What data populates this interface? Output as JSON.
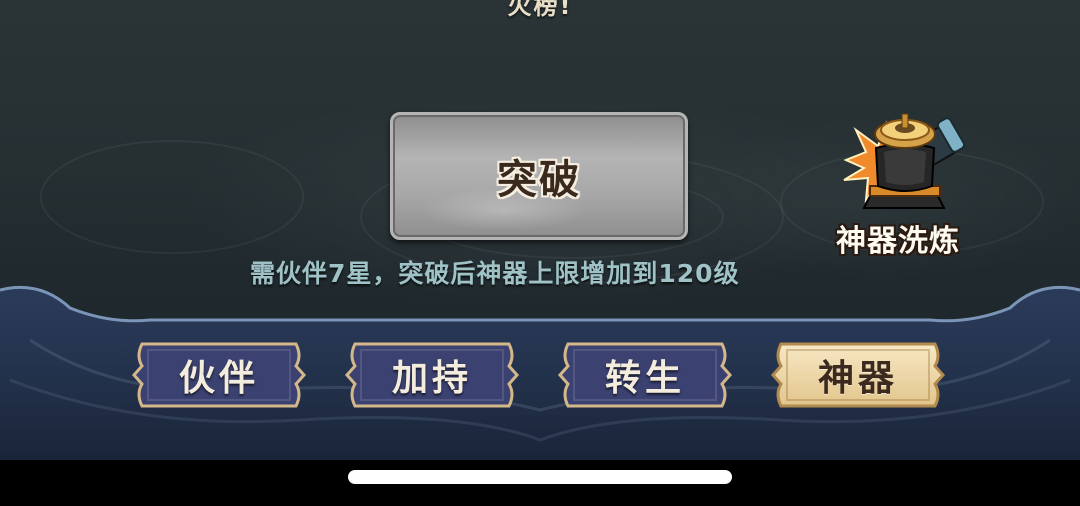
{
  "top_banner": {
    "text": "火榜!"
  },
  "breakthrough": {
    "label": "突破"
  },
  "requirement": {
    "text": "需伙伴7星，突破后神器上限增加到120级"
  },
  "artifact_refine": {
    "label": "神器洗炼",
    "icon": "artifact-cannon-icon"
  },
  "tabs": [
    {
      "label": "伙伴",
      "active": false
    },
    {
      "label": "加持",
      "active": false
    },
    {
      "label": "转生",
      "active": false
    },
    {
      "label": "神器",
      "active": true
    }
  ],
  "colors": {
    "background": "#263033",
    "tab_inactive": "#3a3f6a",
    "tab_active": "#f0dcb0",
    "requirement_text": "#9fc2c6"
  }
}
